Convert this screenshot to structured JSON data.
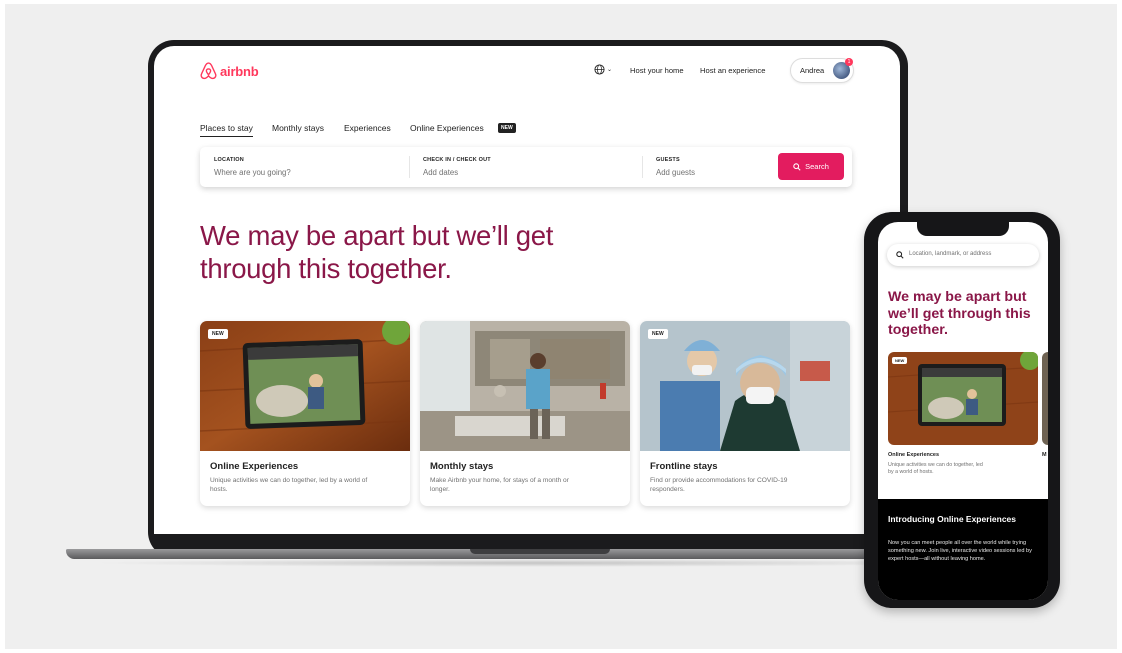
{
  "brand": {
    "name": "airbnb",
    "color": "#ff385c"
  },
  "header": {
    "globe_icon": "globe-icon",
    "links": [
      "Host your home",
      "Host an experience"
    ],
    "user_name": "Andrea",
    "notification_count": "1"
  },
  "tabs": [
    {
      "label": "Places to stay",
      "active": true
    },
    {
      "label": "Monthly stays"
    },
    {
      "label": "Experiences"
    },
    {
      "label": "Online Experiences",
      "badge": "NEW"
    }
  ],
  "search": {
    "location_label": "LOCATION",
    "location_placeholder": "Where are you going?",
    "dates_label": "CHECK IN / CHECK OUT",
    "dates_placeholder": "Add dates",
    "guests_label": "GUESTS",
    "guests_placeholder": "Add guests",
    "button_label": "Search",
    "button_color": "#e31c5f"
  },
  "hero": {
    "line1": "We may be apart but we’ll get",
    "line2": "through this together.",
    "color": "#8a1748"
  },
  "cards": [
    {
      "badge": "NEW",
      "title": "Online Experiences",
      "description": "Unique activities we can do together, led by a world of hosts."
    },
    {
      "title": "Monthly stays",
      "description": "Make Airbnb your home, for stays of a month or longer."
    },
    {
      "badge": "NEW",
      "title": "Frontline stays",
      "description": "Find or provide accommodations for COVID-19 responders."
    }
  ],
  "phone": {
    "search_placeholder": "Location, landmark, or address",
    "hero_line1": "We may be apart but",
    "hero_line2": "we’ll get through this",
    "hero_line3": "together.",
    "card_badge": "NEW",
    "card_title": "Online Experiences",
    "card_description": "Unique activities we can do together, led by a world of hosts.",
    "peek_title": "M",
    "dark_title": "Introducing Online Experiences",
    "dark_description": "Now you can meet people all over the world while trying something new. Join live, interactive video sessions led by expert hosts—all without leaving home."
  }
}
